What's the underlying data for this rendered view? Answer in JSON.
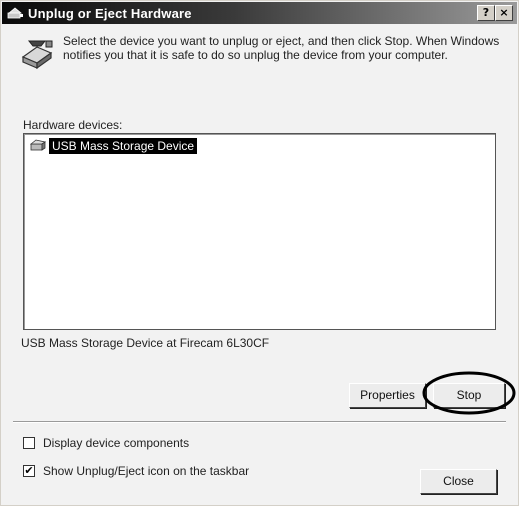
{
  "window": {
    "title": "Unplug or Eject Hardware",
    "help_button": "?",
    "close_button": "×"
  },
  "instructions": "Select the device you want to unplug or eject, and then click Stop. When Windows notifies you that it is safe to do so unplug the device from your computer.",
  "hardware_section": {
    "label": "Hardware devices:",
    "devices": [
      {
        "label": "USB Mass Storage Device",
        "selected": true,
        "icon": "usb-device-icon"
      }
    ]
  },
  "device_status": "USB Mass Storage Device at Firecam 6L30CF",
  "buttons": {
    "properties": "Properties",
    "stop": "Stop",
    "close": "Close"
  },
  "options": {
    "display_components": {
      "label": "Display device components",
      "checked": false
    },
    "show_taskbar_icon": {
      "label": "Show Unplug/Eject icon on the taskbar",
      "checked": true
    }
  },
  "icons": {
    "title": "hardware-eject-icon",
    "main": "hardware-eject-icon"
  },
  "colors": {
    "selection_bg": "#000000",
    "highlight_ring": "#000000"
  }
}
